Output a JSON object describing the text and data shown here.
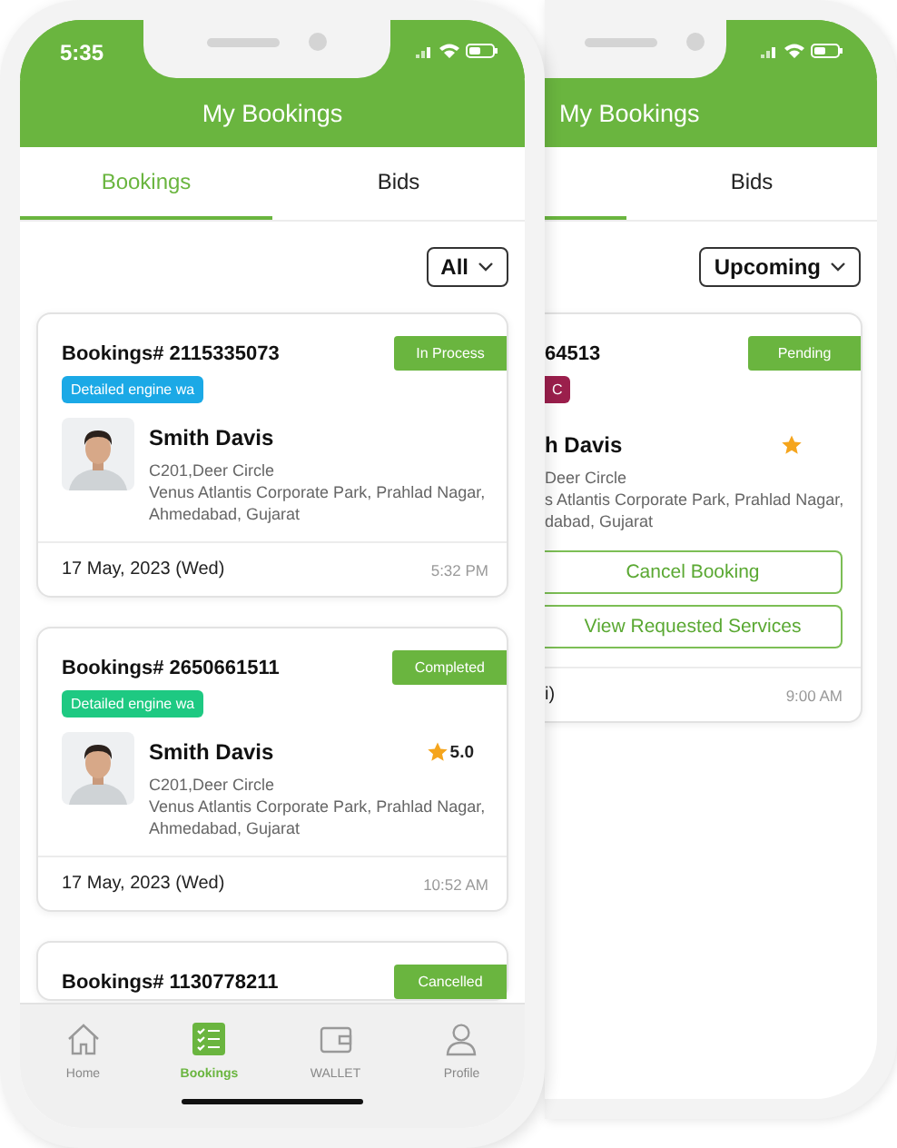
{
  "front": {
    "status_bar": {
      "time": "5:35"
    },
    "title": "My Bookings",
    "tabs": [
      {
        "label": "Bookings",
        "selected": true
      },
      {
        "label": "Bids",
        "selected": false
      }
    ],
    "filter": "All",
    "bookings": [
      {
        "number": "Bookings# 2115335073",
        "status": "In Process",
        "tag": "Detailed engine wa",
        "color": "#1ba9e6",
        "name": "Smith Davis",
        "starred": false,
        "address": [
          "C201,Deer Circle",
          "Venus Atlantis Corporate Park, Prahlad Nagar,",
          "Ahmedabad, Gujarat"
        ],
        "date": "17 May, 2023 (Wed)",
        "time": "5:32 PM"
      },
      {
        "number": "Bookings# 2650661511",
        "status": "Completed",
        "tag": "Detailed engine wa",
        "color": "#1ec982",
        "name": "Smith Davis",
        "starred": true,
        "rating": "5.0",
        "address": [
          "C201,Deer Circle",
          "Venus Atlantis Corporate Park, Prahlad Nagar,",
          "Ahmedabad, Gujarat"
        ],
        "date": "17 May, 2023 (Wed)",
        "time": "10:52 AM"
      },
      {
        "number": "Bookings# 1130778211",
        "status": "Cancelled"
      }
    ],
    "nav": [
      {
        "kind": "home",
        "label": "Home",
        "selected": false
      },
      {
        "kind": "bookings",
        "label": "Bookings",
        "selected": true
      },
      {
        "kind": "wallet",
        "label": "WALLET",
        "selected": false
      },
      {
        "kind": "profile",
        "label": "Profile",
        "selected": false
      }
    ]
  },
  "back": {
    "title": "My Bookings",
    "tabs": [
      {
        "selected": true
      },
      {
        "label": "Bids",
        "selected": false
      }
    ],
    "filter": "Upcoming",
    "booking": {
      "number": "64513",
      "status": "Pending",
      "tag": "C",
      "color": "#9b1f4c",
      "name": "h Davis",
      "starred": true,
      "address": [
        "Deer Circle",
        "s Atlantis Corporate Park, Prahlad Nagar,",
        "dabad, Gujarat"
      ],
      "actions": [
        "Cancel Booking",
        "View Requested Services"
      ],
      "date": "i)",
      "time": "9:00 AM"
    }
  }
}
